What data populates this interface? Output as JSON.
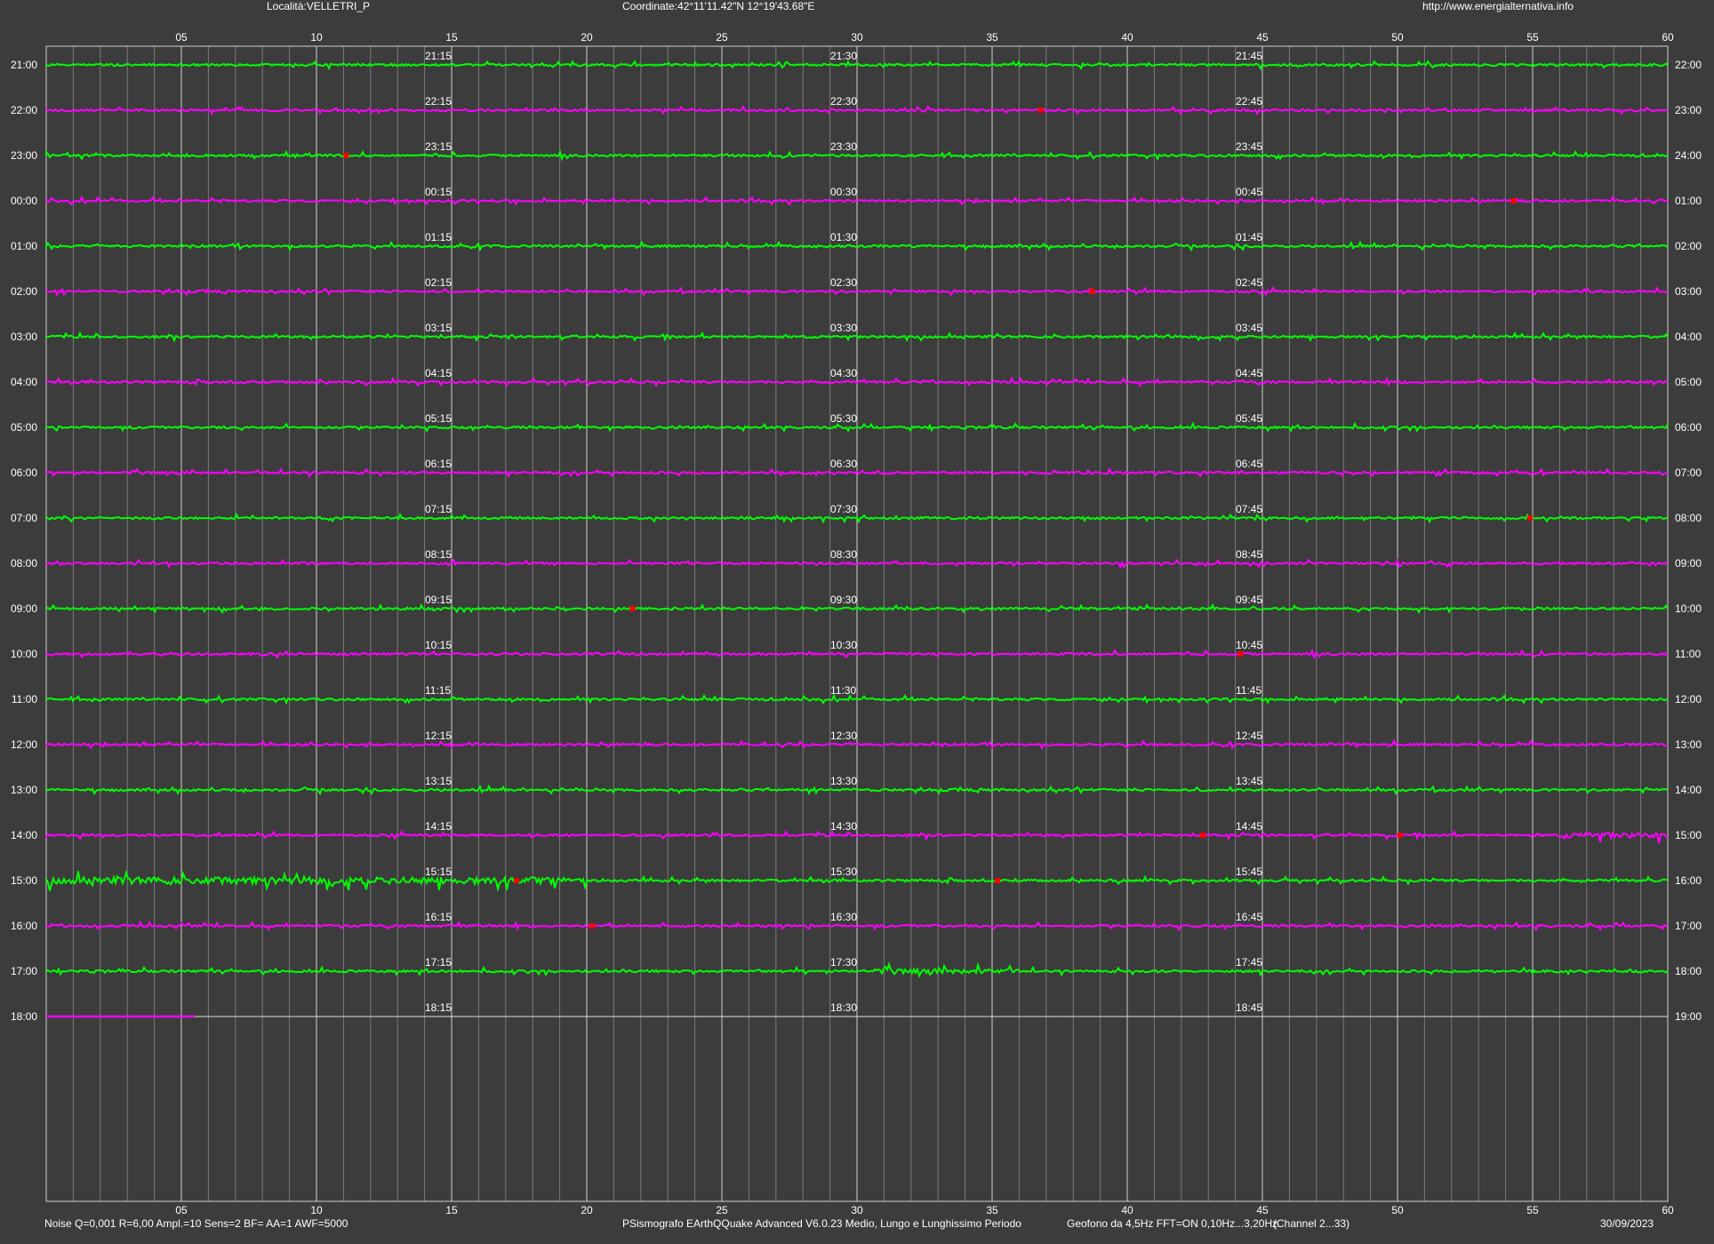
{
  "header": {
    "location": "Località:VELLETRI_P",
    "coordinates": "Coordinate:42°11'11.42\"N  12°19'43.68\"E",
    "url": "http://www.energialternativa.info"
  },
  "footer": {
    "params": "Noise Q=0,001 R=6,00 Ampl.=10 Sens=2 BF= AA=1 AWF=5000",
    "software": "PSismografo  EArthQQuake Advanced V6.0.23  Medio, Lungo e Lunghissimo Periodo",
    "sensor": "Geofono da 4,5Hz FFT=ON 0,10Hz...3,20Hz",
    "channel": "(Channel 2...33)",
    "date": "30/09/2023"
  },
  "colors": {
    "background": "#3c3c3c",
    "plot_background": "#3c3c3c",
    "trace_green": "#00ff00",
    "trace_magenta": "#ff00ff",
    "event_marker": "#ff0000",
    "grid_major": "#d0d0d0",
    "grid_minor": "#7a7a7a",
    "text": "#ffffff"
  },
  "x_axis": {
    "ticks": [
      "05",
      "10",
      "15",
      "20",
      "25",
      "30",
      "35",
      "40",
      "45",
      "50",
      "55",
      "60"
    ]
  },
  "rows": [
    {
      "left": "21:00",
      "right": "22:00",
      "q1": "21:15",
      "q2": "21:30",
      "q3": "21:45",
      "color": "green"
    },
    {
      "left": "22:00",
      "right": "23:00",
      "q1": "22:15",
      "q2": "22:30",
      "q3": "22:45",
      "color": "magenta"
    },
    {
      "left": "23:00",
      "right": "24:00",
      "q1": "23:15",
      "q2": "23:30",
      "q3": "23:45",
      "color": "green"
    },
    {
      "left": "00:00",
      "right": "01:00",
      "q1": "00:15",
      "q2": "00:30",
      "q3": "00:45",
      "color": "magenta"
    },
    {
      "left": "01:00",
      "right": "02:00",
      "q1": "01:15",
      "q2": "01:30",
      "q3": "01:45",
      "color": "green"
    },
    {
      "left": "02:00",
      "right": "03:00",
      "q1": "02:15",
      "q2": "02:30",
      "q3": "02:45",
      "color": "magenta"
    },
    {
      "left": "03:00",
      "right": "04:00",
      "q1": "03:15",
      "q2": "03:30",
      "q3": "03:45",
      "color": "green"
    },
    {
      "left": "04:00",
      "right": "05:00",
      "q1": "04:15",
      "q2": "04:30",
      "q3": "04:45",
      "color": "magenta"
    },
    {
      "left": "05:00",
      "right": "06:00",
      "q1": "05:15",
      "q2": "05:30",
      "q3": "05:45",
      "color": "green"
    },
    {
      "left": "06:00",
      "right": "07:00",
      "q1": "06:15",
      "q2": "06:30",
      "q3": "06:45",
      "color": "magenta"
    },
    {
      "left": "07:00",
      "right": "08:00",
      "q1": "07:15",
      "q2": "07:30",
      "q3": "07:45",
      "color": "green"
    },
    {
      "left": "08:00",
      "right": "09:00",
      "q1": "08:15",
      "q2": "08:30",
      "q3": "08:45",
      "color": "magenta"
    },
    {
      "left": "09:00",
      "right": "10:00",
      "q1": "09:15",
      "q2": "09:30",
      "q3": "09:45",
      "color": "green"
    },
    {
      "left": "10:00",
      "right": "11:00",
      "q1": "10:15",
      "q2": "10:30",
      "q3": "10:45",
      "color": "magenta"
    },
    {
      "left": "11:00",
      "right": "12:00",
      "q1": "11:15",
      "q2": "11:30",
      "q3": "11:45",
      "color": "green"
    },
    {
      "left": "12:00",
      "right": "13:00",
      "q1": "12:15",
      "q2": "12:30",
      "q3": "12:45",
      "color": "magenta"
    },
    {
      "left": "13:00",
      "right": "14:00",
      "q1": "13:15",
      "q2": "13:30",
      "q3": "13:45",
      "color": "green"
    },
    {
      "left": "14:00",
      "right": "15:00",
      "q1": "14:15",
      "q2": "14:30",
      "q3": "14:45",
      "color": "magenta"
    },
    {
      "left": "15:00",
      "right": "16:00",
      "q1": "15:15",
      "q2": "15:30",
      "q3": "15:45",
      "color": "green"
    },
    {
      "left": "16:00",
      "right": "17:00",
      "q1": "16:15",
      "q2": "16:30",
      "q3": "16:45",
      "color": "magenta"
    },
    {
      "left": "17:00",
      "right": "18:00",
      "q1": "17:15",
      "q2": "17:30",
      "q3": "17:45",
      "color": "green"
    },
    {
      "left": "18:00",
      "right": "19:00",
      "q1": "18:15",
      "q2": "18:30",
      "q3": "18:45",
      "color": "magenta"
    }
  ],
  "current_trace_end_minute": 5.5,
  "events": [
    {
      "row": 1,
      "minute": 36.8
    },
    {
      "row": 2,
      "minute": 11.1
    },
    {
      "row": 3,
      "minute": 54.3
    },
    {
      "row": 5,
      "minute": 38.7
    },
    {
      "row": 10,
      "minute": 54.9
    },
    {
      "row": 12,
      "minute": 21.7
    },
    {
      "row": 13,
      "minute": 44.2
    },
    {
      "row": 17,
      "minute": 42.8
    },
    {
      "row": 17,
      "minute": 50.1
    },
    {
      "row": 18,
      "minute": 17.4
    },
    {
      "row": 18,
      "minute": 35.2
    },
    {
      "row": 19,
      "minute": 20.2
    }
  ]
}
